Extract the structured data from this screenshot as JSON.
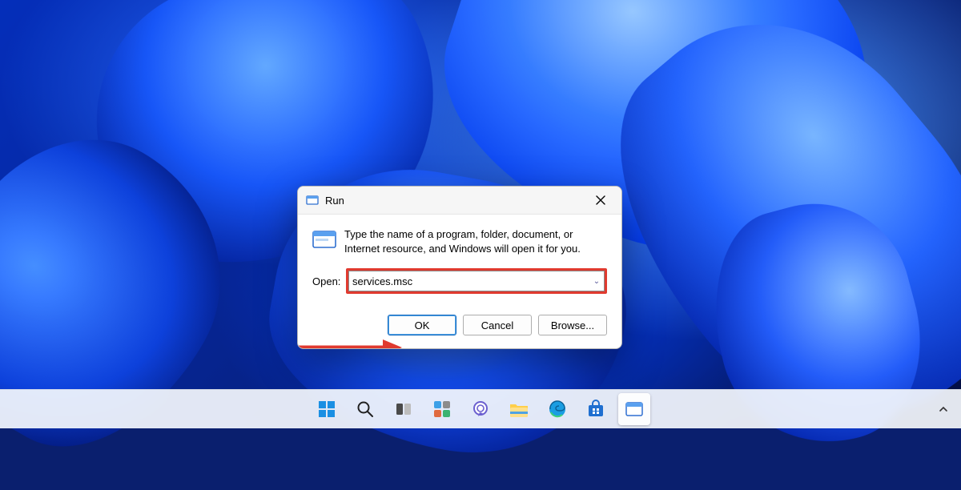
{
  "dialog": {
    "title": "Run",
    "instruction": "Type the name of a program, folder, document, or Internet resource, and Windows will open it for you.",
    "open_label": "Open:",
    "open_value": "services.msc",
    "buttons": {
      "ok": "OK",
      "cancel": "Cancel",
      "browse": "Browse..."
    }
  },
  "taskbar": {
    "items": [
      {
        "name": "start",
        "label": "Start"
      },
      {
        "name": "search",
        "label": "Search"
      },
      {
        "name": "task-view",
        "label": "Task View"
      },
      {
        "name": "widgets",
        "label": "Widgets"
      },
      {
        "name": "chat",
        "label": "Chat"
      },
      {
        "name": "file-explorer",
        "label": "File Explorer"
      },
      {
        "name": "edge",
        "label": "Microsoft Edge"
      },
      {
        "name": "store",
        "label": "Microsoft Store"
      },
      {
        "name": "run-app",
        "label": "Run"
      }
    ]
  },
  "annotations": {
    "highlight": "open-field",
    "arrow_target": "ok-button"
  }
}
